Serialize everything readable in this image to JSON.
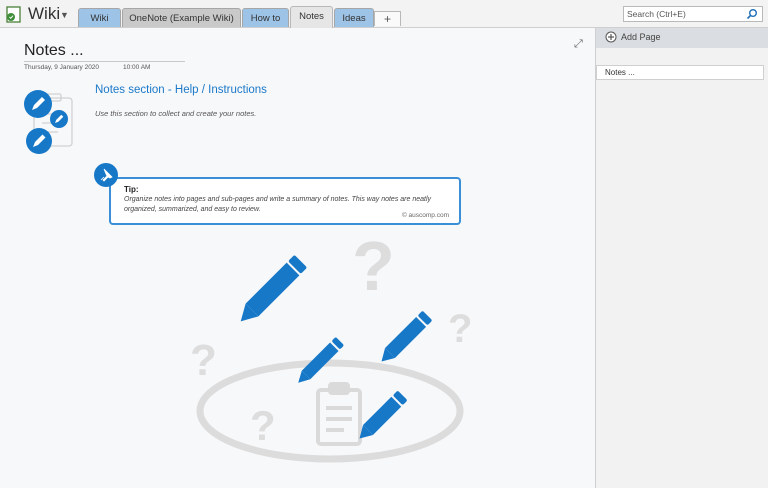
{
  "notebook": {
    "title": "Wiki"
  },
  "tabs": [
    {
      "label": "Wiki",
      "color": "#9dc3e6",
      "active": false
    },
    {
      "label": "OneNote (Example Wiki)",
      "color": "#c9c9c9",
      "active": false
    },
    {
      "label": "How to",
      "color": "#9dc3e6",
      "active": false
    },
    {
      "label": "Notes",
      "color": "#e6e6e6",
      "active": true
    },
    {
      "label": "Ideas",
      "color": "#9dc3e6",
      "active": false
    }
  ],
  "add_tab_label": "+",
  "search": {
    "placeholder": "Search (Ctrl+E)"
  },
  "page": {
    "title": "Notes ...",
    "date": "Thursday, 9 January 2020",
    "time": "10:00 AM",
    "heading": "Notes section - Help / Instructions",
    "description": "Use this section to collect and create your notes.",
    "tip": {
      "label": "Tip:",
      "text": "Organize notes into pages and sub-pages and write a summary of notes. This way notes are neatly organized, summarized, and easy to review.",
      "credit": "© auscomp.com"
    }
  },
  "sidebar": {
    "add_page_label": "Add Page",
    "pages": [
      {
        "label": "Notes ..."
      }
    ]
  },
  "colors": {
    "accent": "#1778c8",
    "tab_blue": "#9dc3e6",
    "tip_border": "#3a8fd6"
  }
}
